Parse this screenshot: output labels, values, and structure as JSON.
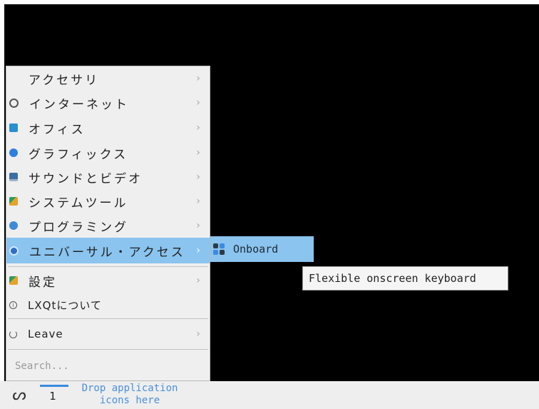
{
  "menu": {
    "items": [
      {
        "label": "アクセサリ",
        "icon": "none",
        "color": "",
        "arrow": "›"
      },
      {
        "label": "インターネット",
        "icon": "globe-icon",
        "color": "#555555",
        "arrow": "›"
      },
      {
        "label": "オフィス",
        "icon": "office-icon",
        "color": "#2a8fcf",
        "arrow": "›"
      },
      {
        "label": "グラフィックス",
        "icon": "graphics-icon",
        "color": "#2f7fe0",
        "arrow": "›"
      },
      {
        "label": "サウンドとビデオ",
        "icon": "multimedia-icon",
        "color": "#3b6ea5",
        "arrow": "›"
      },
      {
        "label": "システムツール",
        "icon": "system-tools-icon",
        "color": "#e4a32a",
        "arrow": "›"
      },
      {
        "label": "プログラミング",
        "icon": "programming-icon",
        "color": "#3d8bd6",
        "arrow": "›"
      },
      {
        "label": "ユニバーサル・アクセス",
        "icon": "accessibility-icon",
        "color": "#2e6fc4",
        "arrow": "›"
      }
    ],
    "settings": {
      "label": "設定",
      "icon": "settings-icon",
      "color": "#e4a32a",
      "arrow": "›"
    },
    "about": {
      "label": "LXQtについて",
      "icon": "info-icon"
    },
    "leave": {
      "label": "Leave",
      "icon": "power-icon",
      "arrow": "›"
    },
    "search_placeholder": "Search..."
  },
  "submenu": {
    "items": [
      {
        "label": "Onboard",
        "icon": "onboard-keyboard-icon"
      }
    ]
  },
  "tooltip": {
    "text": "Flexible onscreen keyboard"
  },
  "taskbar": {
    "start_icon": "lxqt-start-icon",
    "desktop_number": "1",
    "drop_text_line1": "Drop application",
    "drop_text_line2": "icons here"
  },
  "colors": {
    "selection": "#8ac4ef",
    "accent": "#3a8ae0"
  }
}
